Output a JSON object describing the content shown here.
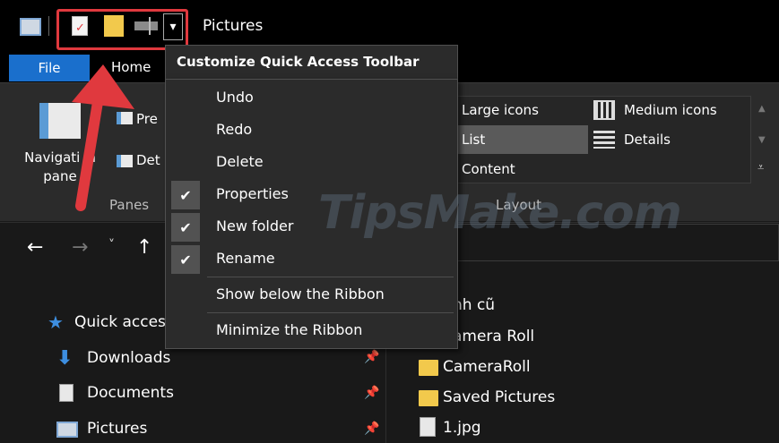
{
  "window": {
    "title": "Pictures"
  },
  "tabs": {
    "file": "File",
    "home": "Home"
  },
  "ribbon": {
    "panes": {
      "nav_label_1": "Navigati",
      "nav_label_2": "n",
      "nav_label_3": "pane",
      "preview": "Pre",
      "details": "Det",
      "group_label": "Panes"
    },
    "layout": {
      "large_icons": "Large icons",
      "medium_icons": "Medium icons",
      "list": "List",
      "details": "Details",
      "content": "Content",
      "group_label": "Layout"
    }
  },
  "menu": {
    "header": "Customize Quick Access Toolbar",
    "items": [
      {
        "label": "Undo",
        "checked": false
      },
      {
        "label": "Redo",
        "checked": false
      },
      {
        "label": "Delete",
        "checked": false
      },
      {
        "label": "Properties",
        "checked": true
      },
      {
        "label": "New folder",
        "checked": true
      },
      {
        "label": "Rename",
        "checked": true
      }
    ],
    "show_below": "Show below the Ribbon",
    "minimize": "Minimize the Ribbon"
  },
  "navigation": {
    "quick_access": "Quick acces",
    "items": [
      "Downloads",
      "Documents",
      "Pictures"
    ]
  },
  "files": {
    "items": [
      "nh cũ",
      "amera Roll",
      "CameraRoll",
      "Saved Pictures",
      "1.jpg"
    ]
  },
  "watermark": "TipsMake.com",
  "colors": {
    "accent": "#1a6fcc",
    "annotation": "#e0393e",
    "folder": "#f2c94c"
  }
}
